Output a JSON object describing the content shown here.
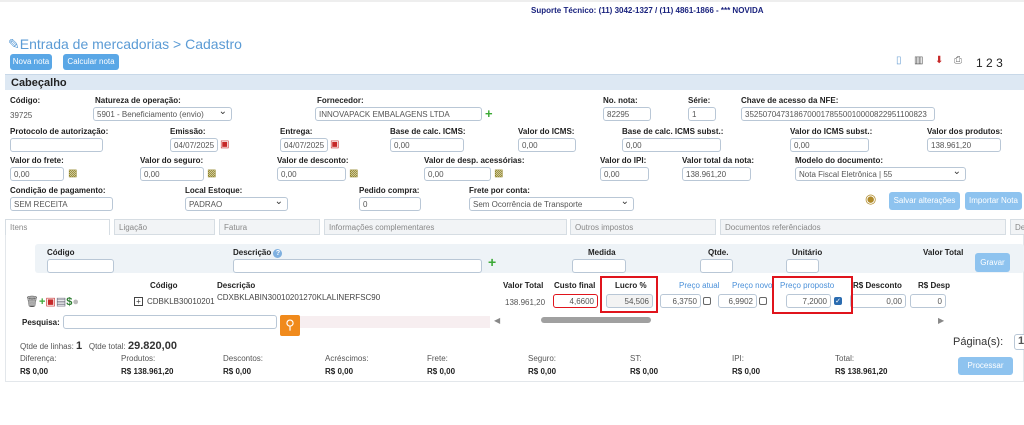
{
  "support": "Suporte Técnico: (11) 3042-1327 / (11) 4861-1866 - *** NOVIDA",
  "title": "Entrada de mercadorias > Cadastro",
  "buttons": {
    "nova": "Nova nota",
    "calcular": "Calcular nota",
    "salvar": "Salvar alterações",
    "importar": "Importar Nota",
    "gravar": "Gravar",
    "processar": "Processar"
  },
  "pages": [
    "1",
    "2",
    "3"
  ],
  "section": "Cabeçalho",
  "fields": {
    "codigo": {
      "label": "Código:",
      "value": "39725"
    },
    "natureza": {
      "label": "Natureza de operação:",
      "value": "5901 - Beneficiamento (envio)"
    },
    "fornecedor": {
      "label": "Fornecedor:",
      "value": "INNOVAPACK EMBALAGENS LTDA"
    },
    "nota": {
      "label": "No. nota:",
      "value": "82295"
    },
    "serie": {
      "label": "Série:",
      "value": "1"
    },
    "chave": {
      "label": "Chave de acesso da NFE:",
      "value": "35250704731867000178550010000822951100823"
    },
    "protocolo": {
      "label": "Protocolo de autorização:",
      "value": ""
    },
    "emissao": {
      "label": "Emissão:",
      "value": "04/07/2025"
    },
    "entrega": {
      "label": "Entrega:",
      "value": "04/07/2025"
    },
    "base_icms": {
      "label": "Base de calc. ICMS:",
      "value": "0,00"
    },
    "valor_icms": {
      "label": "Valor do ICMS:",
      "value": "0,00"
    },
    "base_icms_st": {
      "label": "Base de calc. ICMS subst.:",
      "value": "0,00"
    },
    "valor_icms_st": {
      "label": "Valor do ICMS subst.:",
      "value": "0,00"
    },
    "valor_produtos": {
      "label": "Valor dos produtos:",
      "value": "138.961,20"
    },
    "frete": {
      "label": "Valor do frete:",
      "value": "0,00"
    },
    "seguro": {
      "label": "Valor do seguro:",
      "value": "0,00"
    },
    "desconto": {
      "label": "Valor de desconto:",
      "value": "0,00"
    },
    "despesas": {
      "label": "Valor de desp. acessórias:",
      "value": "0,00"
    },
    "ipi": {
      "label": "Valor do IPI:",
      "value": "0,00"
    },
    "total_nota": {
      "label": "Valor total da nota:",
      "value": "138.961,20"
    },
    "modelo": {
      "label": "Modelo do documento:",
      "value": "Nota Fiscal Eletrônica | 55"
    },
    "condicao": {
      "label": "Condição de pagamento:",
      "value": "SEM RECEITA"
    },
    "local": {
      "label": "Local Estoque:",
      "value": "PADRAO"
    },
    "pedido": {
      "label": "Pedido compra:",
      "value": "0"
    },
    "frete_conta": {
      "label": "Frete por conta:",
      "value": "Sem Ocorrência de Transporte"
    }
  },
  "tabs": [
    "Itens",
    "Ligação",
    "Fatura",
    "Informações complementares",
    "Outros impostos",
    "Documentos referênciados",
    "Devolução"
  ],
  "filter": {
    "codigo": "Código",
    "descricao": "Descrição",
    "medida": "Medida",
    "qtde": "Qtde.",
    "unitario": "Unitário",
    "valor_total": "Valor Total"
  },
  "items": {
    "headers": {
      "codigo": "Código",
      "descricao": "Descrição",
      "valor_total": "Valor Total",
      "custo": "Custo final",
      "lucro": "Lucro %",
      "preco_atual": "Preço atual",
      "preco_novo": "Preço novo",
      "preco_proposto": "Preço proposto",
      "desconto": "R$ Desconto",
      "desp": "R$ Desp"
    },
    "rows": [
      {
        "codigo": "CDBKLB30010201",
        "descricao": "CDXBKLABIN30010201270KLALINERFSC90",
        "valor_total": "138.961,20",
        "custo": "4,6600",
        "lucro": "54,506",
        "preco_atual": "6,3750",
        "preco_novo": "6,9902",
        "preco_proposto": "7,2000",
        "proposto_checked": true,
        "desconto": "0,00",
        "desp": "0"
      }
    ]
  },
  "pesquisa": {
    "label": "Pesquisa:",
    "value": ""
  },
  "footer": {
    "linhas_label": "Qtde de linhas:",
    "linhas": "1",
    "total_label": "Qtde total:",
    "total": "29.820,00",
    "paginas_label": "Página(s):",
    "pagina": "1",
    "summary": [
      {
        "label": "Diferença:",
        "value": "R$ 0,00"
      },
      {
        "label": "Produtos:",
        "value": "R$ 138.961,20"
      },
      {
        "label": "Descontos:",
        "value": "R$ 0,00"
      },
      {
        "label": "Acréscimos:",
        "value": "R$ 0,00"
      },
      {
        "label": "Frete:",
        "value": "R$ 0,00"
      },
      {
        "label": "Seguro:",
        "value": "R$ 0,00"
      },
      {
        "label": "ST:",
        "value": "R$ 0,00"
      },
      {
        "label": "IPI:",
        "value": "R$ 0,00"
      },
      {
        "label": "Total:",
        "value": "R$ 138.961,20"
      }
    ]
  },
  "colors": {
    "accent": "#5aa7e6",
    "highlight": "#e0141c",
    "search": "#f08a1c",
    "header_band": "#dde8f3"
  }
}
